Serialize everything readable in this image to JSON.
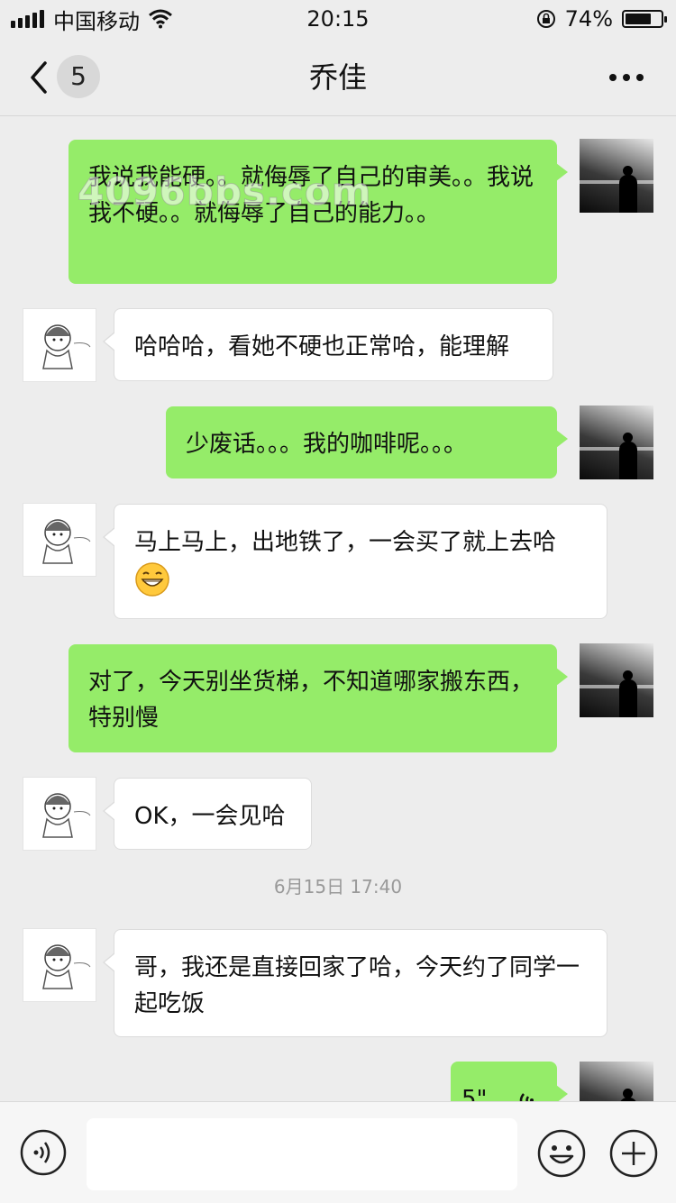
{
  "status_bar": {
    "carrier": "中国移动",
    "time": "20:15",
    "battery_percent": "74%",
    "battery_level": 0.74
  },
  "nav": {
    "unread_count": "5",
    "title": "乔佳"
  },
  "watermark": "4096bbs.com",
  "messages": [
    {
      "side": "right",
      "text": "我说我能硬。。就侮辱了自己的审美。。我说我不硬。。就侮辱了自己的能力。。"
    },
    {
      "side": "left",
      "text": "哈哈哈，看她不硬也正常哈，能理解"
    },
    {
      "side": "right",
      "text": "少废话。。。我的咖啡呢。。。"
    },
    {
      "side": "left",
      "text": "马上马上，出地铁了，一会买了就上去哈"
    },
    {
      "side": "right",
      "text": "对了，今天别坐货梯，不知道哪家搬东西，特别慢"
    },
    {
      "side": "left",
      "text": "OK，一会见哈"
    },
    {
      "side": "left",
      "text": "哥，我还是直接回家了哈，今天约了同学一起吃饭"
    },
    {
      "side": "right",
      "text": "5\""
    }
  ],
  "timestamp": "6月15日 17:40",
  "icons": {
    "back": "chevron-left-icon",
    "more": "more-dots-icon",
    "voice": "voice-icon",
    "emoji": "emoji-icon",
    "plus": "plus-icon"
  },
  "colors": {
    "background": "#ededed",
    "bubble_sent": "#95ec69",
    "bubble_received": "#ffffff"
  }
}
